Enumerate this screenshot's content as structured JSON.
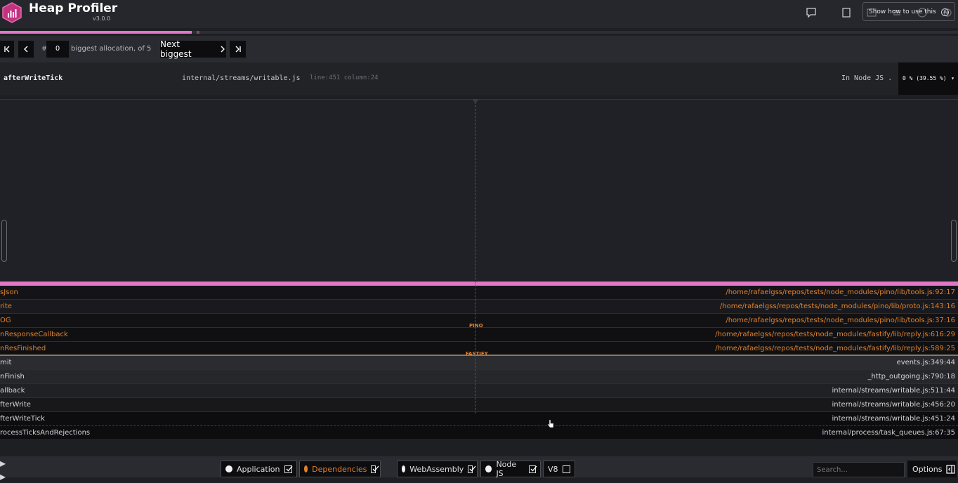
{
  "app": {
    "title": "Heap Profiler",
    "version": "v3.0.0"
  },
  "header": {
    "tooltip_text": "Show how to use this",
    "tooltip_close": "x"
  },
  "progress": {
    "fraction": 0.2,
    "tick_fraction": 0.205,
    "accent": "#e276c8"
  },
  "nav": {
    "first_icon": "first-page-icon",
    "prev_icon": "previous-icon",
    "hash": "#",
    "current_index": "0",
    "description": "biggest allocation, of 5",
    "next_label": "Next biggest",
    "next_icon": "chevron-right-icon",
    "last_icon": "last-page-icon"
  },
  "frame": {
    "function": "afterWriteTick",
    "file": "internal/streams/writable.js",
    "location": "line:451 column:24",
    "category": "In Node JS .",
    "percent": "0 % (39.55 %)"
  },
  "stack": [
    {
      "fn": "sJson",
      "path": "/home/rafaelgss/repos/tests/node_modules/pino/lib/tools.js:92:17",
      "kind": "dep"
    },
    {
      "fn": "rite",
      "path": "/home/rafaelgss/repos/tests/node_modules/pino/lib/proto.js:143:16",
      "kind": "dep"
    },
    {
      "fn": "OG",
      "path": "/home/rafaelgss/repos/tests/node_modules/pino/lib/tools.js:37:16",
      "kind": "dep"
    },
    {
      "fn": "nResponseCallback",
      "path": "/home/rafaelgss/repos/tests/node_modules/fastify/lib/reply.js:616:29",
      "kind": "dep"
    },
    {
      "fn": "nResFinished",
      "path": "/home/rafaelgss/repos/tests/node_modules/fastify/lib/reply.js:589:25",
      "kind": "dep"
    },
    {
      "fn": "mit",
      "path": "events.js:349:44",
      "kind": "nat"
    },
    {
      "fn": "nFinish",
      "path": "_http_outgoing.js:790:18",
      "kind": "nat"
    },
    {
      "fn": "allback",
      "path": "internal/streams/writable.js:511:44",
      "kind": "nat"
    },
    {
      "fn": "fterWrite",
      "path": "internal/streams/writable.js:456:20",
      "kind": "nat"
    },
    {
      "fn": "fterWriteTick",
      "path": "internal/streams/writable.js:451:24",
      "kind": "nat"
    },
    {
      "fn": "rocessTicksAndRejections",
      "path": "internal/process/task_queues.js:67:35",
      "kind": "nat"
    }
  ],
  "groups": {
    "pino": "PINO",
    "fastify": "FASTIFY"
  },
  "footer": {
    "tabs": {
      "application": "Application",
      "dependencies": "Dependencies",
      "webassembly": "WebAssembly",
      "nodejs": "Node JS",
      "v8": "V8"
    },
    "search_placeholder": "Search...",
    "options": "Options"
  },
  "colors": {
    "dependency": "#e0812c",
    "accent": "#e276c8",
    "background": "#1e1f23"
  }
}
